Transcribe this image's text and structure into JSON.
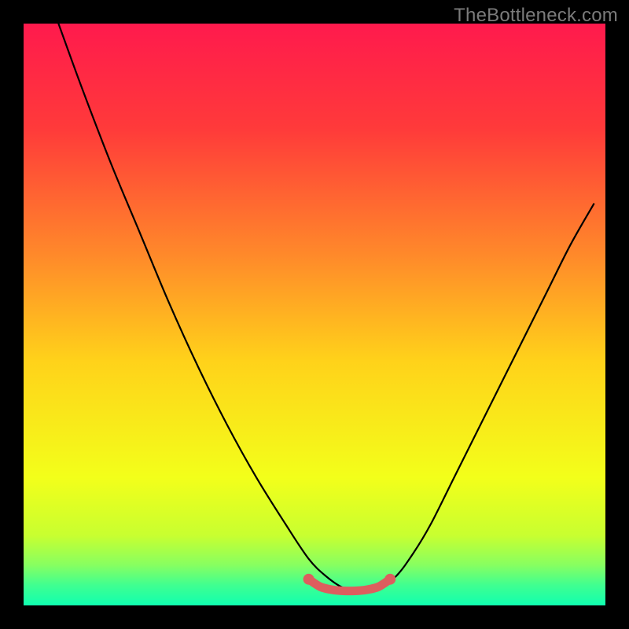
{
  "watermark": "TheBottleneck.com",
  "colors": {
    "frame": "#000000",
    "gradient_stops": [
      {
        "offset": 0.0,
        "color": "#ff1a4d"
      },
      {
        "offset": 0.18,
        "color": "#ff3a3a"
      },
      {
        "offset": 0.4,
        "color": "#ff8a2a"
      },
      {
        "offset": 0.58,
        "color": "#ffd21a"
      },
      {
        "offset": 0.78,
        "color": "#f3ff1a"
      },
      {
        "offset": 0.88,
        "color": "#c8ff30"
      },
      {
        "offset": 0.93,
        "color": "#88ff60"
      },
      {
        "offset": 0.965,
        "color": "#40ff90"
      },
      {
        "offset": 1.0,
        "color": "#10ffb0"
      }
    ],
    "curve": "#000000",
    "marker": "#dd5e5e"
  },
  "chart_data": {
    "type": "line",
    "title": "",
    "xlabel": "",
    "ylabel": "",
    "xlim": [
      0,
      100
    ],
    "ylim": [
      0,
      100
    ],
    "categories_note": "no axis ticks or labels shown; x and y are in percent of plot area, origin top‑left so higher y means lower on screen",
    "series": [
      {
        "name": "bottleneck-curve",
        "x": [
          6,
          10,
          15,
          20,
          25,
          30,
          35,
          40,
          45,
          49,
          52,
          55,
          58,
          61,
          64,
          67,
          70,
          74,
          78,
          82,
          86,
          90,
          94,
          98
        ],
        "y": [
          0,
          11,
          24,
          36,
          48,
          59,
          69,
          78,
          86,
          92,
          95,
          97,
          97.5,
          97,
          95,
          91,
          86,
          78,
          70,
          62,
          54,
          46,
          38,
          31
        ]
      }
    ],
    "highlight_segment": {
      "name": "optimal-range",
      "x": [
        49,
        51,
        53,
        55,
        57,
        59,
        61,
        63
      ],
      "y": [
        95.5,
        96.8,
        97.3,
        97.5,
        97.5,
        97.3,
        96.8,
        95.5
      ]
    }
  }
}
